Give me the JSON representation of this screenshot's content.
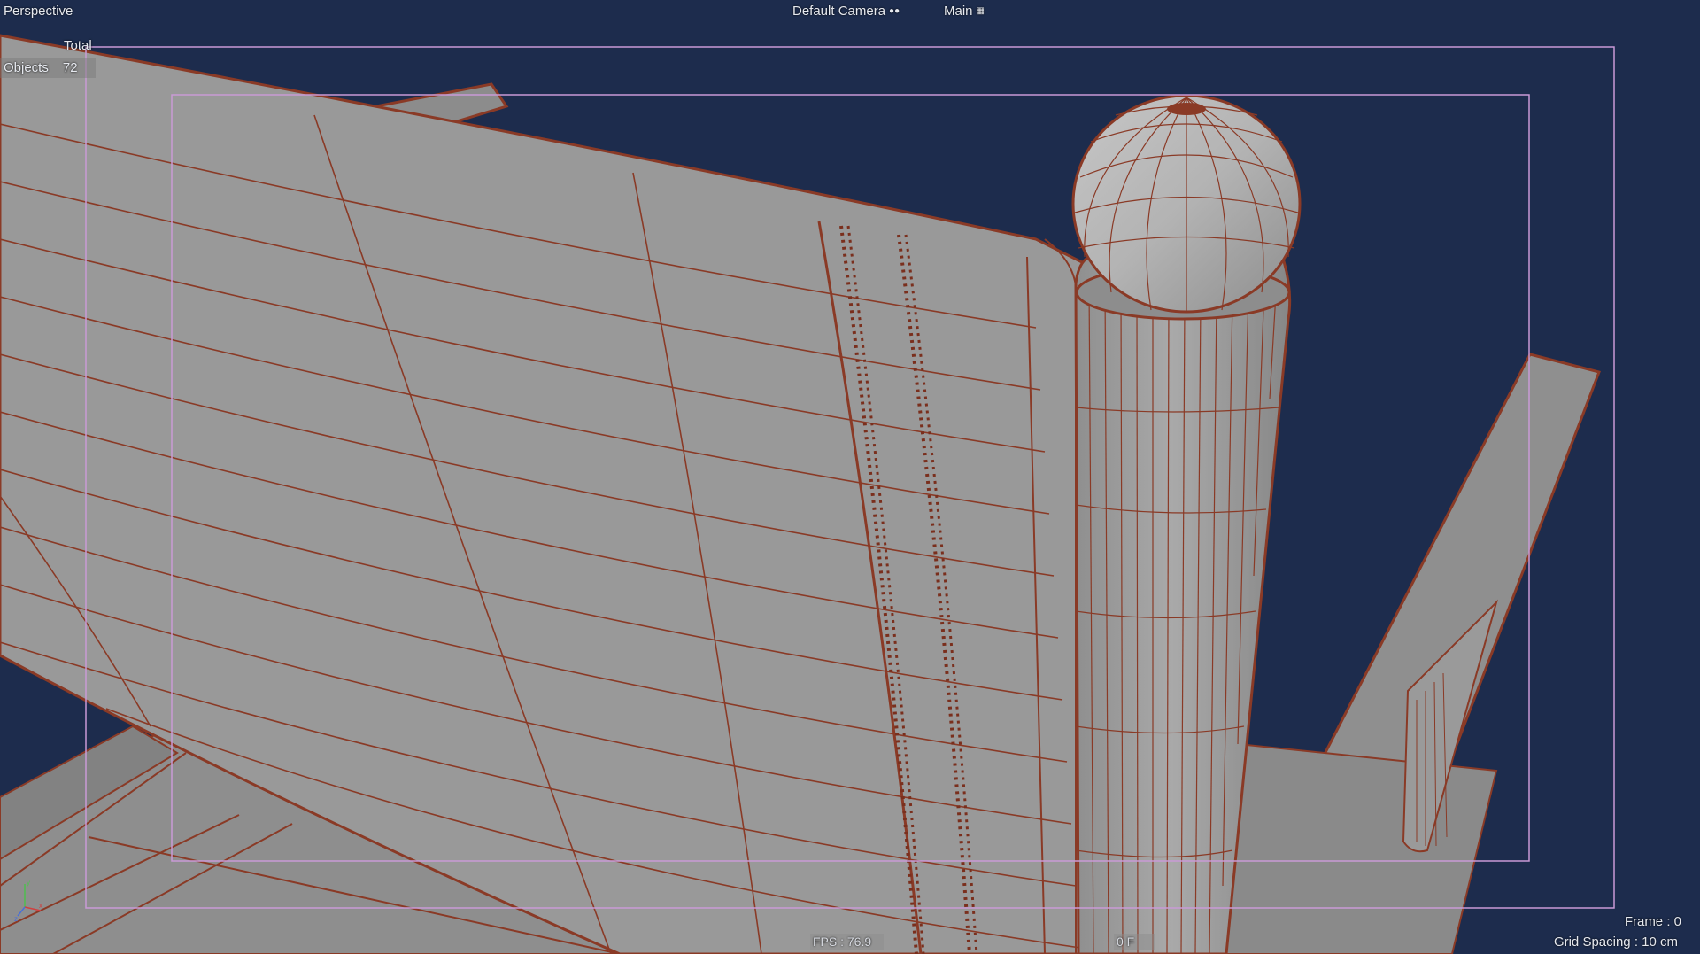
{
  "viewport": {
    "view_name": "Perspective",
    "camera_label": "Default Camera",
    "camera_icon": "camera-icon",
    "display_label": "Main",
    "display_icon": "display-icon",
    "background_color": "#1d2c4d",
    "safe_frame_color": "#c99ad6",
    "wire_color": "#8a3a26",
    "surface_color": "#9c9c9c"
  },
  "stats": {
    "total_label": "Total",
    "objects_label": "Objects",
    "objects_count": "72"
  },
  "footer": {
    "fps": "FPS : 76.9",
    "frame_field": "0 F",
    "frame": "Frame : 0",
    "grid_spacing": "Grid Spacing : 10 cm"
  },
  "axis_gizmo": {
    "x": "x",
    "y": "y",
    "z": "z"
  }
}
